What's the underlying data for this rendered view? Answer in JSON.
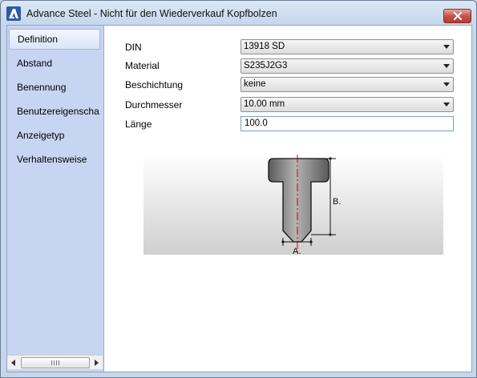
{
  "window": {
    "title": "Advance Steel - Nicht für den Wiederverkauf   Kopfbolzen",
    "app_icon": "autodesk-a-icon",
    "close_icon": "close-icon"
  },
  "sidebar": {
    "items": [
      {
        "label": "Definition",
        "active": true
      },
      {
        "label": "Abstand",
        "active": false
      },
      {
        "label": "Benennung",
        "active": false
      },
      {
        "label": "Benutzereigenscha...",
        "active": false
      },
      {
        "label": "Anzeigetyp",
        "active": false
      },
      {
        "label": "Verhaltensweise",
        "active": false
      }
    ],
    "scroll_thumb_glyph": "|||"
  },
  "form": {
    "din": {
      "label": "DIN",
      "value": "13918 SD"
    },
    "material": {
      "label": "Material",
      "value": "S235J2G3"
    },
    "beschichtung": {
      "label": "Beschichtung",
      "value": "keine"
    },
    "durchmesser": {
      "label": "Durchmesser",
      "value": "10.00 mm"
    },
    "laenge": {
      "label": "Länge",
      "value": "100.0"
    }
  },
  "diagram": {
    "label_a": "A.",
    "label_b": "B."
  },
  "colors": {
    "accent": "#c7d4f2",
    "close_button": "#c75050",
    "center_line": "#cc0000"
  }
}
